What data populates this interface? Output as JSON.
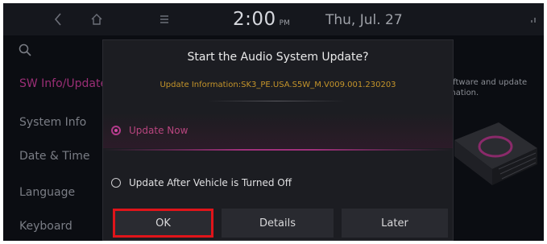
{
  "status_bar": {
    "back_icon": "chevron-left-icon",
    "home_icon": "home-icon",
    "menu_icon": "menu-icon",
    "time": "2:00",
    "ampm": "PM",
    "date": "Thu, Jul. 27",
    "signal_icon": "signal-icon"
  },
  "sidebar": {
    "search_icon": "search-icon",
    "items": [
      {
        "label": "SW Info/Update",
        "active": true
      },
      {
        "label": "System Info"
      },
      {
        "label": "Date & Time"
      },
      {
        "label": "Language"
      },
      {
        "label": "Keyboard"
      }
    ]
  },
  "background": {
    "description_fragment": "oftware and update\nmation."
  },
  "dialog": {
    "title": "Start the Audio System Update?",
    "info": "Update Information:SK3_PE.USA.S5W_M.V009.001.230203",
    "options": [
      {
        "label": "Update Now",
        "selected": true
      },
      {
        "label": "Update After Vehicle is Turned Off",
        "selected": false
      }
    ],
    "buttons": {
      "ok": "OK",
      "details": "Details",
      "later": "Later"
    }
  },
  "colors": {
    "accent": "#b23a8a",
    "info_text": "#c4942a",
    "highlight_border": "#e0141a"
  }
}
